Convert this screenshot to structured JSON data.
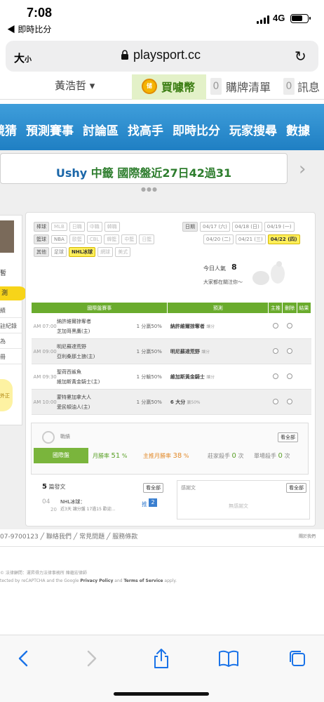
{
  "status": {
    "time": "7:08",
    "back_app": "◀ 即時比分",
    "network": "4G"
  },
  "browser": {
    "font_size_label": "大",
    "font_size_small": "小",
    "url": "playsport.cc"
  },
  "site_top": {
    "username": "黃浩哲 ▾",
    "coin_icon_text": "储",
    "buy_coin": "買噱幣",
    "cart_count": "0",
    "cart_label": "購牌清單",
    "msg_count": "0",
    "msg_label": "訊息"
  },
  "nav": {
    "items": [
      "競猜",
      "預測賽事",
      "討論區",
      "找高手",
      "即時比分",
      "玩家搜尋",
      "數據"
    ]
  },
  "ticker": {
    "user": "Ushy",
    "text": " 中籤 國際盤近27日42過31"
  },
  "left_col": {
    "label1": "暫",
    "active": "測",
    "items": [
      "績",
      "註紀錄",
      "為",
      "冊"
    ],
    "bulb": "外正"
  },
  "filters": {
    "row1_label": "棒球",
    "row1": [
      "MLB",
      "日職",
      "中職",
      "韓職"
    ],
    "row2_label": "籃球",
    "row2": [
      "NBA",
      "歐籃",
      "CBL",
      "韓籃",
      "中籃",
      "日籃"
    ],
    "row3_label": "其他",
    "row3": [
      "足球",
      "NHL冰球",
      "網球",
      "美式"
    ],
    "date_label": "日期",
    "dates_row1": [
      "04/17 (六)",
      "04/18 (日)",
      "04/19 (一)"
    ],
    "dates_row2": [
      "04/20 (二)",
      "04/21 (三)",
      "04/22 (四)"
    ]
  },
  "popularity": {
    "label": "今日人氣",
    "value": "8",
    "follow": "大家都在關注你～"
  },
  "table": {
    "headers": [
      "國際盤賽事",
      "預測",
      "主推",
      "刪除",
      "結果"
    ],
    "rows": [
      {
        "time": "AM 07:00",
        "team1": "納許維爾掠奪者",
        "team2": "芝加哥黑鷹(主)",
        "odds": "1 分贏50%",
        "pred": "納許維爾掠奪者",
        "pred_note": "讓分"
      },
      {
        "time": "AM 09:00",
        "team1": "明尼蘇達荒野",
        "team2": "亞利桑那土狼(主)",
        "odds": "1 分贏50%",
        "pred": "明尼蘇達荒野",
        "pred_note": "讓分"
      },
      {
        "time": "AM 09:30",
        "team1": "聖荷西鯊魚",
        "team2": "維加斯黃金騎士(主)",
        "odds": "1 分輸50%",
        "pred": "維加斯黃金騎士",
        "pred_note": "讓分"
      },
      {
        "time": "AM 10:00",
        "team1": "蒙特婁加拿大人",
        "team2": "愛民頓油人(主)",
        "odds": "1 分贏50%",
        "pred": "6 大分",
        "pred_note": "贏50%"
      }
    ]
  },
  "record": {
    "label": "戰績",
    "see_all": "看全部",
    "tab": "國際盤",
    "stats": [
      {
        "label": "月勝率",
        "value": "51",
        "unit": "%"
      },
      {
        "label": "主推月勝率",
        "value": "38",
        "unit": "%"
      },
      {
        "label": "莊家殺手",
        "value": "0",
        "unit": "次"
      },
      {
        "label": "單場殺手",
        "value": "0",
        "unit": "次"
      }
    ]
  },
  "posts": {
    "count": "5",
    "title": "篇發文",
    "see_all": "看全部",
    "month": "04",
    "day": "20",
    "post_title": "NHL冰球：",
    "post_sub": "近3天 讓分盤 17過15 歡迎...",
    "push_label": "推",
    "push_count": "2"
  },
  "thanks": {
    "title": "感謝文",
    "see_all": "看全部",
    "empty": "無感謝文"
  },
  "footer": {
    "line1": "07-9700123 ╱ 聯絡我們 ╱ 常見問題 ╱ 服務條款",
    "about": "關於我們",
    "line2": "© 法律顧問：運昇得力法律事務所 陳蘊宏律師",
    "line3_pre": "tected by reCAPTCHA and the Google ",
    "privacy": "Privacy Policy",
    "and": " and ",
    "terms": "Terms of Service",
    "apply": " apply."
  }
}
